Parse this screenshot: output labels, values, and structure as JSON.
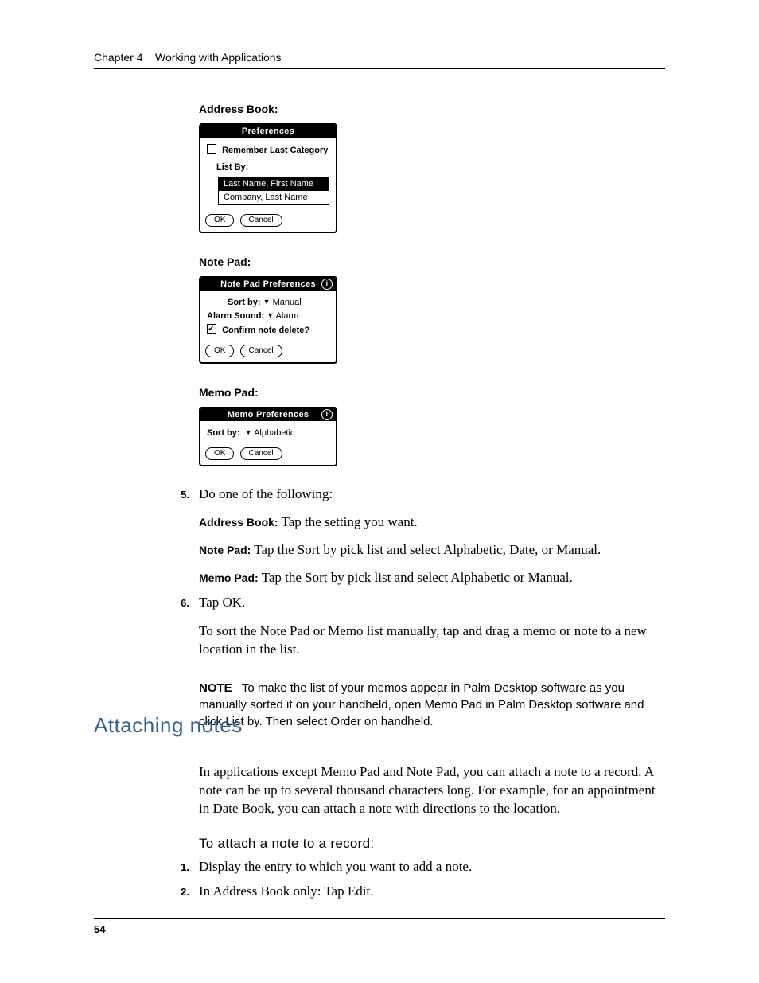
{
  "header": {
    "chapter": "Chapter 4",
    "title": "Working with Applications"
  },
  "address_book_label": "Address Book:",
  "note_pad_label": "Note Pad:",
  "memo_pad_label": "Memo Pad:",
  "dlg_address": {
    "title": "Preferences",
    "remember": "Remember Last Category",
    "listby_label": "List By:",
    "opt_selected": "Last Name, First Name",
    "opt_other": "Company, Last Name",
    "ok": "OK",
    "cancel": "Cancel"
  },
  "dlg_notepad": {
    "title": "Note Pad Preferences",
    "sortby_label": "Sort by:",
    "sortby_value": "Manual",
    "alarm_label": "Alarm Sound:",
    "alarm_value": "Alarm",
    "confirm_label": "Confirm note delete?",
    "ok": "OK",
    "cancel": "Cancel"
  },
  "dlg_memopad": {
    "title": "Memo Preferences",
    "sortby_label": "Sort by:",
    "sortby_value": "Alphabetic",
    "ok": "OK",
    "cancel": "Cancel"
  },
  "step5_num": "5.",
  "step5_lead": "Do one of the following:",
  "step5_a_label": "Address Book:",
  "step5_a_text": "Tap the setting you want.",
  "step5_b_label": "Note Pad:",
  "step5_b_text": "Tap the Sort by pick list and select Alphabetic, Date, or Manual.",
  "step5_c_label": "Memo Pad:",
  "step5_c_text": "Tap the Sort by pick list and select Alphabetic or Manual.",
  "step6_num": "6.",
  "step6_text": "Tap OK.",
  "after_steps_para": "To sort the Note Pad or Memo list manually, tap and drag a memo or note to a new location in the list.",
  "note_label": "NOTE",
  "note_text": "To make the list of your memos appear in Palm Desktop software as you manually sorted it on your handheld, open Memo Pad in Palm Desktop software and click List by. Then select Order on handheld.",
  "section_heading": "Attaching notes",
  "section_intro": "In applications except Memo Pad and Note Pad, you can attach a note to a record. A note can be up to several thousand characters long. For example, for an appointment in Date Book, you can attach a note with directions to the location.",
  "subhead": "To attach a note to a record:",
  "sub1_num": "1.",
  "sub1_text": "Display the entry to which you want to add a note.",
  "sub2_num": "2.",
  "sub2_text": "In Address Book only: Tap Edit.",
  "page_number": "54"
}
